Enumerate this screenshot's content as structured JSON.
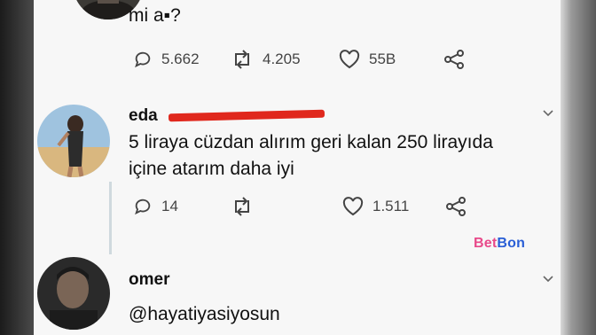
{
  "tweets": [
    {
      "text_line": "mi a▪?",
      "stats": {
        "replies": "5.662",
        "retweets": "4.205",
        "likes": "55B"
      }
    },
    {
      "name": "eda",
      "text_line1": "5 liraya cüzdan alırım geri kalan 250 lirayıda",
      "text_line2": "içine atarım daha iyi",
      "stats": {
        "replies": "14",
        "retweets": "",
        "likes": "1.511"
      }
    },
    {
      "name": "omer",
      "text": "@hayatiyasiyosun"
    }
  ],
  "watermark": {
    "part1": "Bet",
    "part2": "Bon"
  },
  "colors": {
    "card": "#f7f7f7",
    "text": "#111111",
    "redaction": "#e0281d",
    "thread_line": "#cfd9de"
  },
  "icons": [
    "reply-icon",
    "retweet-icon",
    "like-icon",
    "share-icon",
    "chevron-down-icon"
  ]
}
